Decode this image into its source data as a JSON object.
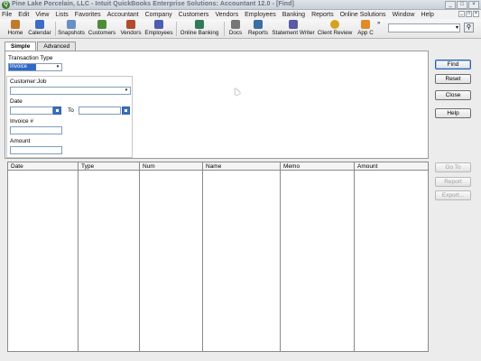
{
  "window": {
    "app_icon": "Q",
    "title": "Pine Lake Porcelain, LLC - Intuit QuickBooks Enterprise Solutions: Accountant 12.0 - [Find]",
    "controls": [
      "_",
      "□",
      "×"
    ]
  },
  "menu": {
    "items": [
      "File",
      "Edit",
      "View",
      "Lists",
      "Favorites",
      "Accountant",
      "Company",
      "Customers",
      "Vendors",
      "Employees",
      "Banking",
      "Reports",
      "Online Solutions",
      "Window",
      "Help"
    ],
    "mdi_controls": [
      "_",
      "□",
      "×"
    ]
  },
  "toolbar": {
    "items": [
      {
        "label": "Home",
        "icon": "home-icon",
        "color": "#c07a2e"
      },
      {
        "label": "Calendar",
        "icon": "calendar-icon",
        "color": "#3b6fc3"
      },
      {
        "label": "Snapshots",
        "icon": "snapshots-icon",
        "color": "#6a8fc8"
      },
      {
        "label": "Customers",
        "icon": "customers-icon",
        "color": "#4f8c3a"
      },
      {
        "label": "Vendors",
        "icon": "vendors-icon",
        "color": "#b24b2f"
      },
      {
        "label": "Employees",
        "icon": "employees-icon",
        "color": "#4c5fb0"
      },
      {
        "label": "Online Banking",
        "icon": "online-banking-icon",
        "color": "#2f7a5b"
      },
      {
        "label": "Docs",
        "icon": "docs-icon",
        "color": "#777777"
      },
      {
        "label": "Reports",
        "icon": "reports-icon",
        "color": "#3a6ea5"
      },
      {
        "label": "Statement Writer",
        "icon": "statement-writer-icon",
        "color": "#5a5aa8"
      },
      {
        "label": "Client Review",
        "icon": "client-review-icon",
        "color": "#d6a21e"
      },
      {
        "label": "App C",
        "icon": "app-center-icon",
        "color": "#e08a2a"
      }
    ],
    "more": "»",
    "search_dropdown": "▾",
    "search_button": "⚲"
  },
  "tabs": [
    {
      "label": "Simple",
      "active": true
    },
    {
      "label": "Advanced",
      "active": false
    }
  ],
  "form": {
    "transaction_type_label": "Transaction Type",
    "transaction_type_value": "Invoice",
    "dropdown_arrow": "▾",
    "customer_job_label": "Customer:Job",
    "date_label": "Date",
    "to_label": "To",
    "invoice_label": "Invoice #",
    "amount_label": "Amount"
  },
  "buttons": {
    "find": "Find",
    "reset": "Reset",
    "close": "Close",
    "help": "Help",
    "go_to": "Go To",
    "report": "Report",
    "export": "Export..."
  },
  "results": {
    "columns": [
      "Date",
      "Type",
      "Num",
      "Name",
      "Memo",
      "Amount"
    ],
    "rows": []
  }
}
